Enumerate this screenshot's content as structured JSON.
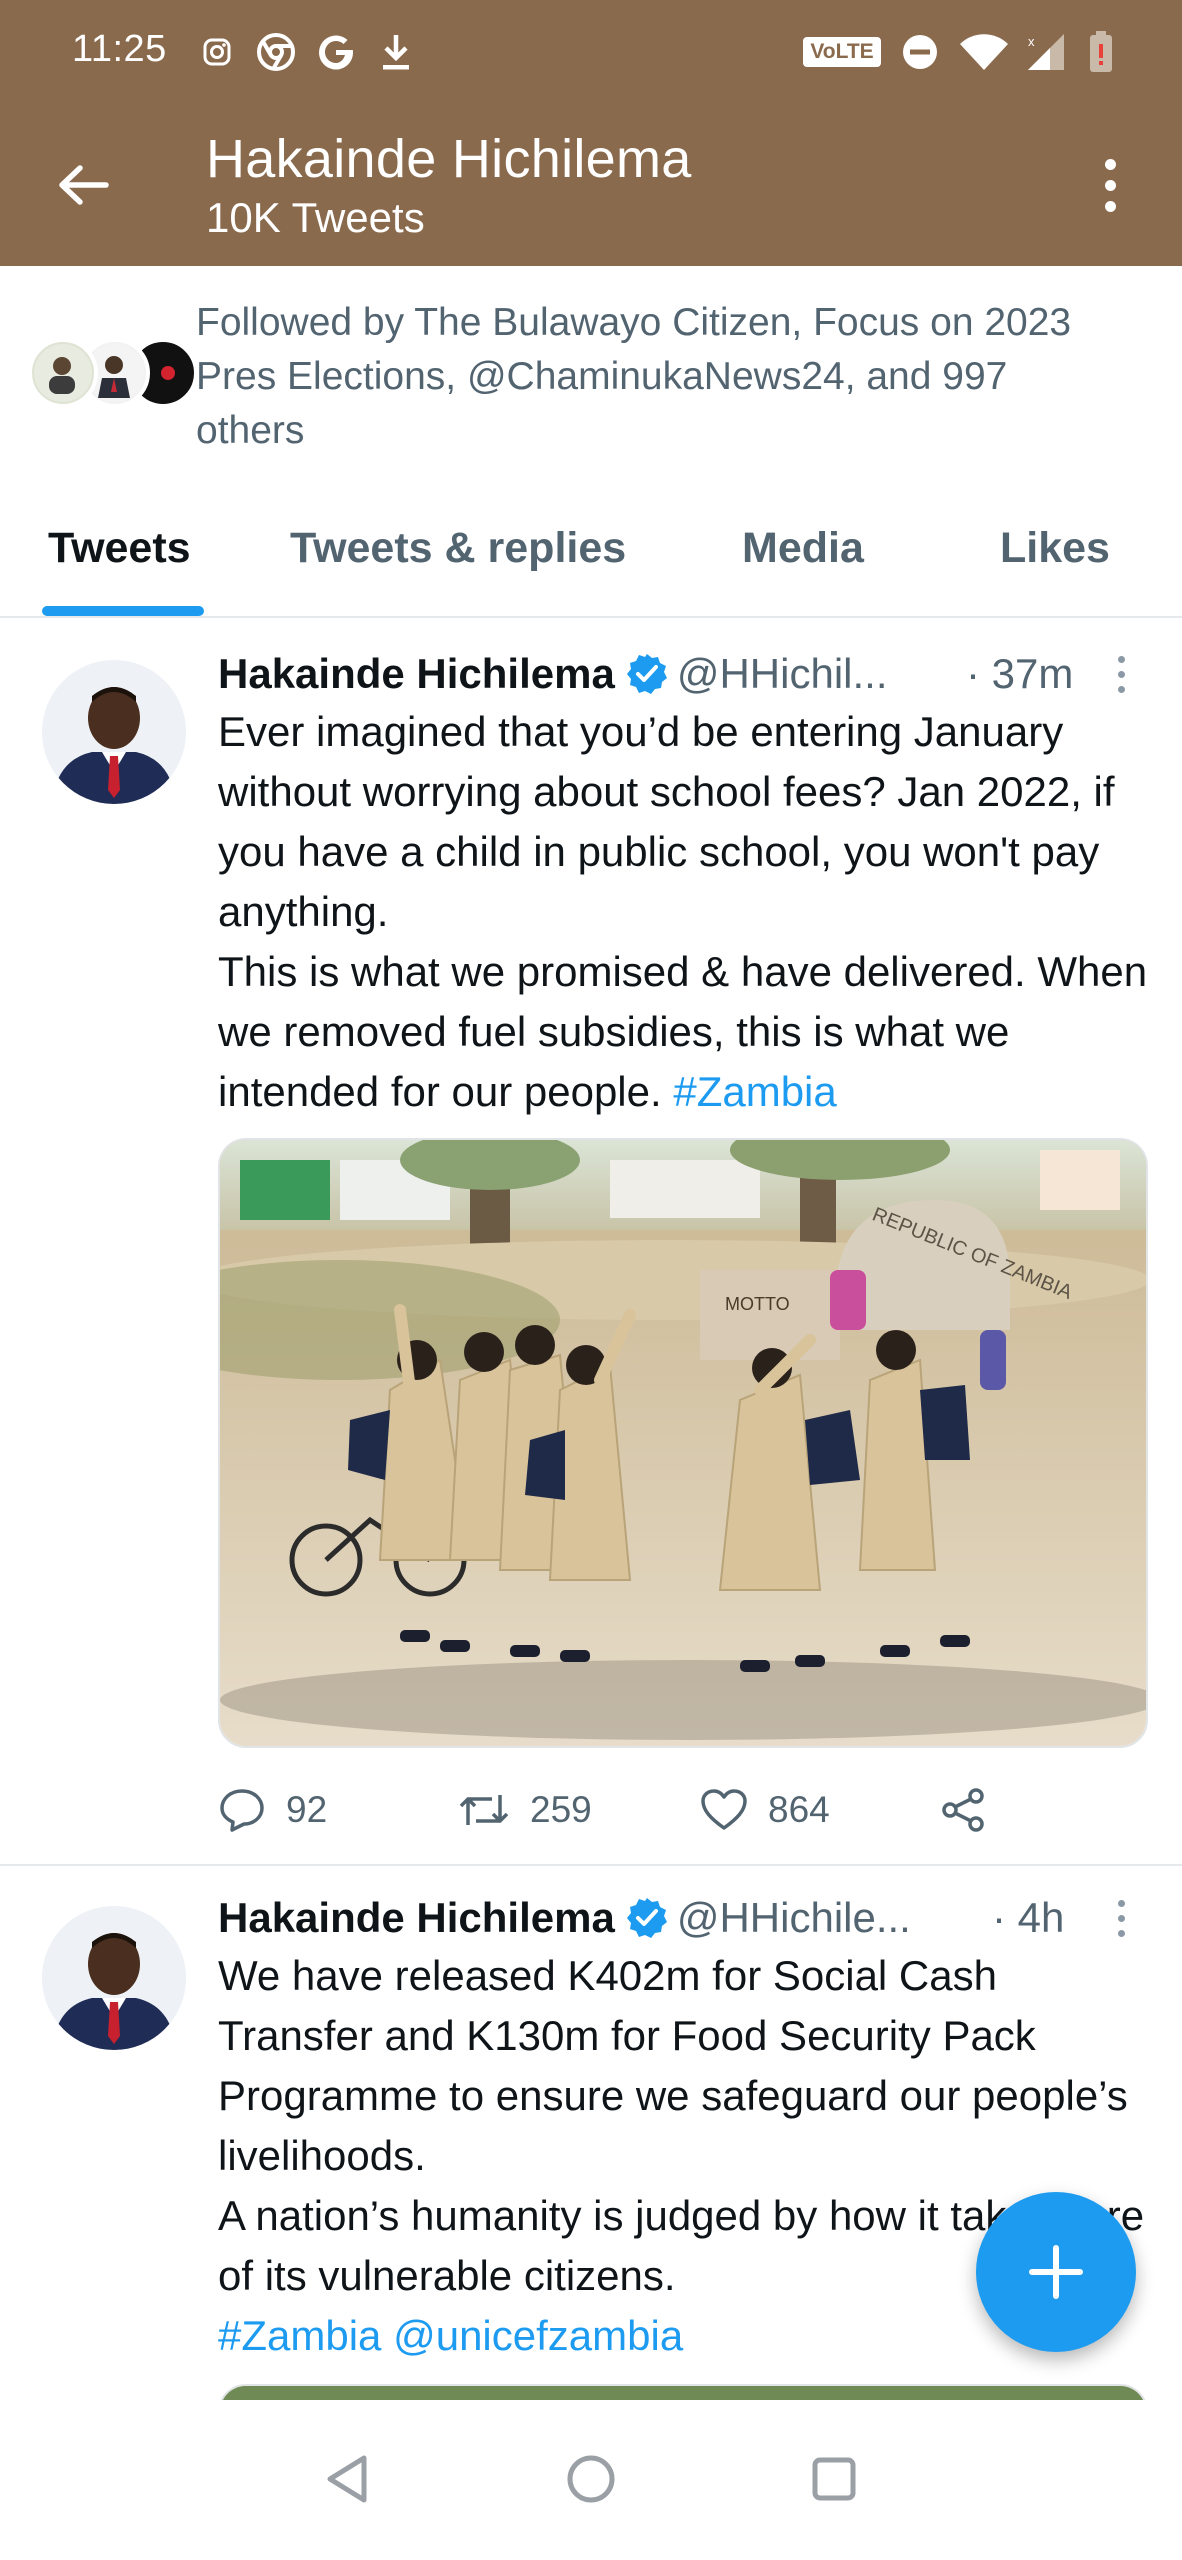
{
  "status_bar": {
    "time": "11:25",
    "network_label": "VoLTE",
    "icons": [
      "instagram-icon",
      "chrome-icon",
      "google-icon",
      "download-icon",
      "dnd-icon",
      "wifi-icon",
      "signal-icon",
      "battery-low-icon"
    ]
  },
  "header": {
    "title": "Hakainde Hichilema",
    "subtitle": "10K Tweets",
    "back_icon": "arrow-left-icon",
    "more_icon": "overflow-menu-icon"
  },
  "followed_by": {
    "text": "Followed by The Bulawayo Citizen, Focus on 2023 Pres Elections, @ChaminukaNews24, and 997 others"
  },
  "tabs": [
    {
      "label": "Tweets",
      "active": true
    },
    {
      "label": "Tweets & replies",
      "active": false
    },
    {
      "label": "Media",
      "active": false
    },
    {
      "label": "Likes",
      "active": false
    }
  ],
  "tweets": [
    {
      "name": "Hakainde Hichilema",
      "handle": "@HHichil...",
      "time": "· 37m",
      "lines": [
        "Ever imagined that you’d be entering January without worrying about school fees? Jan 2022, if you have a child in public school, you won't pay anything.",
        "This is what we promised & have delivered. When we removed fuel subsidies, this is what we intended for our people."
      ],
      "hashtag": "#Zambia",
      "image_sign_text": "REPUBLIC OF ZAMBIA",
      "image_motto_text": "MOTTO",
      "replies": "92",
      "retweets": "259",
      "likes": "864"
    },
    {
      "name": "Hakainde Hichilema",
      "handle": "@HHichile...",
      "time": "· 4h",
      "lines": [
        "We have released K402m for Social Cash Transfer and K130m for Food Security Pack Programme to ensure we safeguard our people’s livelihoods.",
        "A nation’s humanity is judged by how it takes care of its vulnerable citizens."
      ],
      "tags": "#Zambia @unicefzambia"
    }
  ],
  "colors": {
    "header_bg": "#8a6a4d",
    "accent": "#1d9bf0",
    "text_primary": "#0f1419",
    "text_secondary": "#536471"
  },
  "fab_icon": "compose-plus-icon",
  "nav_icons": [
    "back-triangle-icon",
    "home-circle-icon",
    "recents-square-icon"
  ]
}
